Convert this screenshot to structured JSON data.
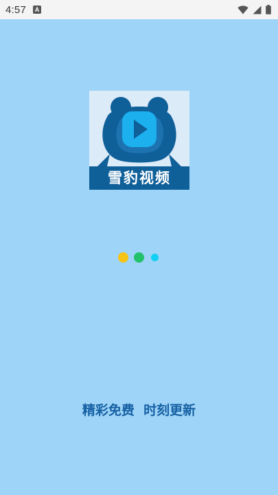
{
  "status_bar": {
    "time": "4:57",
    "notification_letter": "A",
    "icons": [
      "wifi-icon",
      "cellular-signal-icon",
      "battery-icon"
    ]
  },
  "logo": {
    "title": "雪豹视频",
    "icon": "snow-leopard-play-icon",
    "colors": {
      "background": "#dcebf8",
      "head": "#0f5f99",
      "head_light": "#1d72b0",
      "play": "#1cb0ef",
      "banner": "#0f5f99"
    }
  },
  "loading": {
    "dot_colors": [
      "#f7c316",
      "#22c16a",
      "#11d0f4"
    ]
  },
  "tagline": "精彩免费  时刻更新",
  "colors": {
    "screen_background": "#9ed4f8",
    "status_bar": "#f4f4f4",
    "tagline": "#1560a3"
  }
}
